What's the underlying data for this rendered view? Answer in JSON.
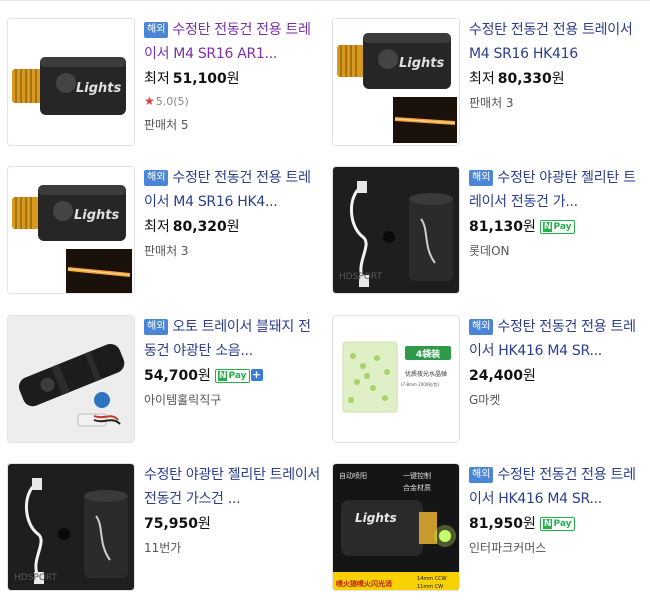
{
  "items": [
    {
      "badge": "해외",
      "title": "수정탄 전동건 전용 트레이서 M4 SR16 AR1...",
      "price_prefix": "최저",
      "price": "51,100",
      "won": "원",
      "rating": "5.0(5)",
      "seller": "판매처 5"
    },
    {
      "title": "수정탄 전동건 전용 트레이서 M4 SR16 HK416",
      "price_prefix": "최저",
      "price": "80,330",
      "won": "원",
      "seller": "판매처 3"
    },
    {
      "badge": "해외",
      "title": "수정탄 전동건 전용 트레이서 M4 SR16 HK4...",
      "price_prefix": "최저",
      "price": "80,320",
      "won": "원",
      "seller": "판매처 3"
    },
    {
      "badge": "해외",
      "title": "수정탄 야광탄 젤리탄 트레이서 전동건 가...",
      "price": "81,130",
      "won": "원",
      "npay": "Pay",
      "seller": "롯데ON"
    },
    {
      "badge": "해외",
      "title": "오토 트레이서 블돼지 전동건 야광탄 소음...",
      "price": "54,700",
      "won": "원",
      "npay": "Pay",
      "npay_plus": "+",
      "seller": "아이템홀릭직구"
    },
    {
      "badge": "해외",
      "title": "수정탄 전동건 전용 트레이서 HK416 M4 SR...",
      "price": "24,400",
      "won": "원",
      "seller": "G마켓"
    },
    {
      "title": "수정탄 야광탄 젤리탄 트레이서 전동건 가스건 ...",
      "price": "75,950",
      "won": "원",
      "seller": "11번가"
    },
    {
      "badge": "해외",
      "title": "수정탄 전동건 전용 트레이서 HK416 M4 SR...",
      "price": "81,950",
      "won": "원",
      "npay": "Pay",
      "seller": "인터파크커머스"
    }
  ],
  "image_text": {
    "lights": "Lights",
    "brand": "HDSPORT",
    "four_bags": "4袋装",
    "packet_label": "优质夜光水晶弹",
    "packet_sub": "(7-8mm 2000粒/包)",
    "auto_fire": "自动喷阳",
    "one_key": "一键控制",
    "alloy": "合金材质",
    "banner": "喷火狼喷火闪光消",
    "spec1": "14mm CCW",
    "spec2": "11mm CW"
  },
  "colors": {
    "title": "#2c3e8c",
    "visited_title": "#7a2ea8",
    "badge": "#4b86d6",
    "npay": "#22b04b",
    "star": "#e63c3c"
  }
}
